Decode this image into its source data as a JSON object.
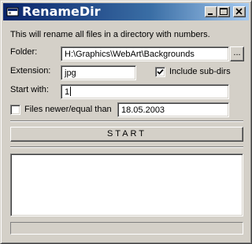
{
  "window": {
    "title": "RenameDir",
    "icon": "app-window-icon",
    "caption_buttons": [
      "minimize-icon",
      "maximize-icon",
      "close-icon"
    ]
  },
  "intro_text": "This will rename all files in a directory with numbers.",
  "folder": {
    "label": "Folder:",
    "value": "H:\\Graphics\\WebArt\\Backgrounds",
    "browse_label": "..."
  },
  "extension": {
    "label": "Extension:",
    "value": "jpg"
  },
  "include_subdirs": {
    "label": "Include sub-dirs",
    "checked": true
  },
  "start_with": {
    "label": "Start with:",
    "value": "1"
  },
  "files_newer": {
    "label": "Files newer/equal than",
    "checked": false,
    "date_value": "18.05.2003"
  },
  "start_button": {
    "label": "START"
  },
  "log_lines": [],
  "progress": {
    "fraction": 0
  },
  "colors": {
    "face": "#d4d0c8",
    "titlebar_start": "#0a246a",
    "titlebar_end": "#a6caf0",
    "field_background": "#ffffff"
  }
}
